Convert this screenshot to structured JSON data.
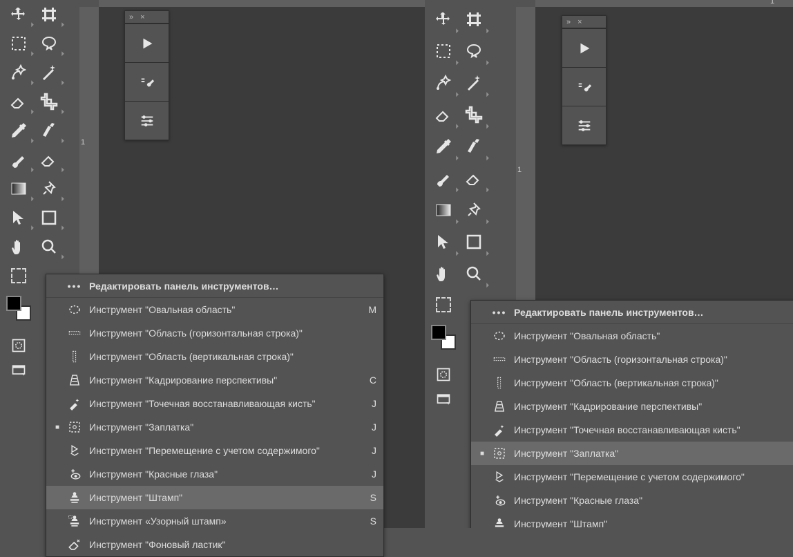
{
  "ruler": {
    "top_label": "1",
    "left_label_a": "1",
    "left_label_b": "1"
  },
  "actions_panel": {
    "collapse": "»",
    "close": "×"
  },
  "toolbar_tools": {
    "move": "move",
    "artboard": "artboard",
    "marquee": "rectangular-marquee",
    "lasso": "lasso",
    "quicksel": "quick-selection",
    "magicwand": "magic-wand",
    "crop": "crop",
    "slice": "slice",
    "eyedrop": "eyedropper",
    "ruler": "ruler",
    "brush": "brush",
    "eraser": "eraser",
    "gradient": "gradient",
    "pen": "pen",
    "pathsel": "path-selection",
    "shape": "rectangle-shape",
    "hand": "hand",
    "zoom": "zoom"
  },
  "flyout": {
    "header": "Редактировать панель инструментов…",
    "items": [
      {
        "label": "Инструмент \"Овальная область\"",
        "key": "M",
        "icon": "oval"
      },
      {
        "label": "Инструмент \"Область (горизонтальная строка)\"",
        "key": "",
        "icon": "rowmarq"
      },
      {
        "label": "Инструмент \"Область (вертикальная строка)\"",
        "key": "",
        "icon": "colmarq"
      },
      {
        "label": "Инструмент \"Кадрирование перспективы\"",
        "key": "C",
        "icon": "pcrop"
      },
      {
        "label": "Инструмент \"Точечная восстанавливающая кисть\"",
        "key": "J",
        "icon": "spotheal"
      },
      {
        "label": "Инструмент \"Заплатка\"",
        "key": "J",
        "icon": "patch",
        "marker": true
      },
      {
        "label": "Инструмент \"Перемещение с учетом содержимого\"",
        "key": "J",
        "icon": "contentmove"
      },
      {
        "label": "Инструмент \"Красные глаза\"",
        "key": "J",
        "icon": "redeye"
      },
      {
        "label": "Инструмент \"Штамп\"",
        "key": "S",
        "icon": "stamp"
      },
      {
        "label": "Инструмент «Узорный штамп»",
        "key": "S",
        "icon": "patstamp"
      },
      {
        "label": "Инструмент \"Фоновый ластик\"",
        "key": "",
        "icon": "bgerase"
      }
    ],
    "left_selected_index": 8,
    "right_selected_index": 5
  }
}
